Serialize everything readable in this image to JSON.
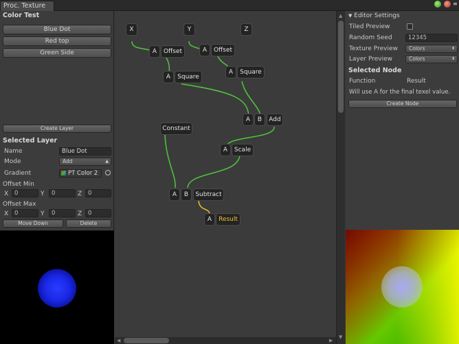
{
  "window": {
    "tab_title": "Proc. Texture"
  },
  "left": {
    "texture_name": "Color Test",
    "layers": [
      "Blue Dot",
      "Red top",
      "Green Side"
    ],
    "create_layer": "Create Layer",
    "selected_layer_header": "Selected Layer",
    "name_label": "Name",
    "name_value": "Blue Dot",
    "mode_label": "Mode",
    "mode_value": "Add",
    "gradient_label": "Gradient",
    "gradient_value": "PT Color 2",
    "offset_min_label": "Offset Min",
    "offset_max_label": "Offset Max",
    "x_label": "X",
    "y_label": "Y",
    "z_label": "Z",
    "offset_min": {
      "x": "0",
      "y": "0",
      "z": "0"
    },
    "offset_max": {
      "x": "0",
      "y": "0",
      "z": "0"
    },
    "move_down": "Move Down",
    "delete": "Delete"
  },
  "graph": {
    "nodes": {
      "x": "X",
      "y": "Y",
      "z": "Z",
      "a": "A",
      "b": "B",
      "offset": "Offset",
      "square": "Square",
      "add": "Add",
      "constant": "Constant",
      "scale": "Scale",
      "subtract": "Subtract",
      "result": "Result"
    },
    "wire_color": "#4ec83a",
    "result_wire_color": "#e8c22a"
  },
  "right": {
    "settings_header": "Editor Settings",
    "tiled_preview_label": "Tiled Preview",
    "random_seed_label": "Random Seed",
    "random_seed_value": "12345",
    "texture_preview_label": "Texture Preview",
    "texture_preview_value": "Colors",
    "layer_preview_label": "Layer Preview",
    "layer_preview_value": "Colors",
    "selected_node_header": "Selected Node",
    "function_label": "Function",
    "function_value": "Result",
    "info_text": "Will use A for the final texel value.",
    "create_node": "Create Node"
  }
}
